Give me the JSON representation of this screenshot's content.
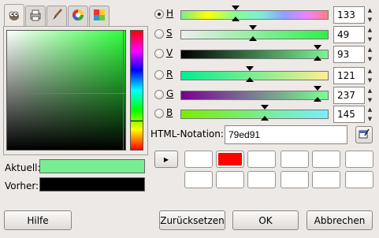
{
  "tabs": [
    {
      "icon": "gimp-icon",
      "active": true
    },
    {
      "icon": "printer-icon",
      "active": false
    },
    {
      "icon": "brush-icon",
      "active": false
    },
    {
      "icon": "color-wheel-icon",
      "active": false
    },
    {
      "icon": "palette-icon",
      "active": false
    }
  ],
  "swatches": {
    "current_label": "Aktuell:",
    "current_color": "#79ed91",
    "previous_label": "Vorher:",
    "previous_color": "#000000"
  },
  "rows": [
    {
      "key": "h",
      "label": "H",
      "value": "133",
      "checked": true,
      "marker_fraction": 0.37,
      "marker_dir": "up"
    },
    {
      "key": "s",
      "label": "S",
      "value": "49",
      "checked": false,
      "marker_fraction": 0.49,
      "marker_dir": "up"
    },
    {
      "key": "v",
      "label": "V",
      "value": "93",
      "checked": false,
      "marker_fraction": 0.93,
      "marker_dir": "up"
    },
    {
      "key": "r",
      "label": "R",
      "value": "121",
      "checked": false,
      "marker_fraction": 0.47,
      "marker_dir": "up"
    },
    {
      "key": "g",
      "label": "G",
      "value": "237",
      "checked": false,
      "marker_fraction": 0.93,
      "marker_dir": "up"
    },
    {
      "key": "b",
      "label": "B",
      "value": "145",
      "checked": false,
      "marker_fraction": 0.57,
      "marker_dir": "up"
    }
  ],
  "html_notation": {
    "label": "HTML-Notation:",
    "value": "79ed91"
  },
  "history": {
    "colors": [
      "#ffffff",
      "#ff0000",
      "#ffffff",
      "#ffffff",
      "#ffffff",
      "#ffffff",
      "#ffffff",
      "#ffffff",
      "#ffffff",
      "#ffffff",
      "#ffffff",
      "#ffffff"
    ]
  },
  "buttons": {
    "help": "Hilfe",
    "reset": "Zurücksetzen",
    "ok": "OK",
    "cancel": "Abbrechen"
  }
}
